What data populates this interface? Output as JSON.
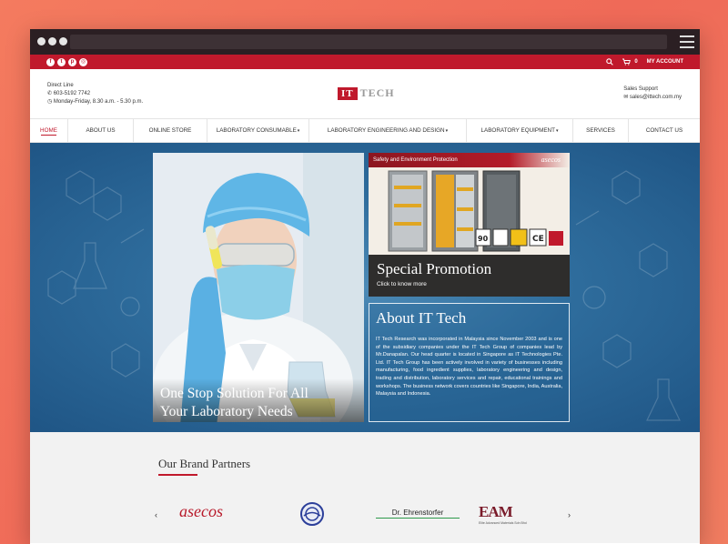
{
  "topbar": {
    "social": [
      "f",
      "t",
      "p",
      "◎"
    ],
    "cart_count": "0",
    "my_account": "MY ACCOUNT"
  },
  "header": {
    "direct_line_label": "Direct Line",
    "phone": "603-5192 7742",
    "hours": "Monday-Friday, 8.30 a.m. - 5.30 p.m.",
    "logo_box": "IT",
    "logo_text": "TECH",
    "support_label": "Sales Support",
    "support_email": "sales@ittech.com.my"
  },
  "nav": {
    "items": [
      {
        "label": "HOME"
      },
      {
        "label": "ABOUT US"
      },
      {
        "label": "ONLINE STORE"
      },
      {
        "label": "LABORATORY CONSUMABLE"
      },
      {
        "label": "LABORATORY ENGINEERING AND DESIGN"
      },
      {
        "label": "LABORATORY EQUIPMENT"
      },
      {
        "label": "SERVICES"
      },
      {
        "label": "CONTACT US"
      }
    ]
  },
  "hero": {
    "caption_line1": "One Stop Solution For All",
    "caption_line2": "Your Laboratory Needs",
    "promo_banner": "Safety and Environment Protection",
    "promo_brand": "asecos",
    "promo_title": "Special Promotion",
    "promo_link": "Click to know more",
    "about_title": "About IT Tech",
    "about_text": "IT Tech Research was incorporated in Malaysia since November 2003 and is one of the subsidiary companies under the IT Tech Group of companies lead by Mr.Danapalan. Our head quarter is located in Singapore as IT Technologies Pte. Ltd. IT Tech Group has been actively involved in variety of businesses including manufacturing, food ingredient supplies, laboratory engineering and design, trading and distribution, laboratory services and repair, educational trainings and workshops. The business network covers countries like Singapore, India, Australia, Malaysia and Indonesia."
  },
  "brands": {
    "title": "Our Brand Partners",
    "prev": "‹",
    "next": "›",
    "logos": {
      "asecos": "asecos",
      "ehrenstorfer": "Dr. Ehrenstorfer",
      "eam": "EAM",
      "eam_sub": "Elite Advanced Materials Sdn Bhd"
    }
  }
}
